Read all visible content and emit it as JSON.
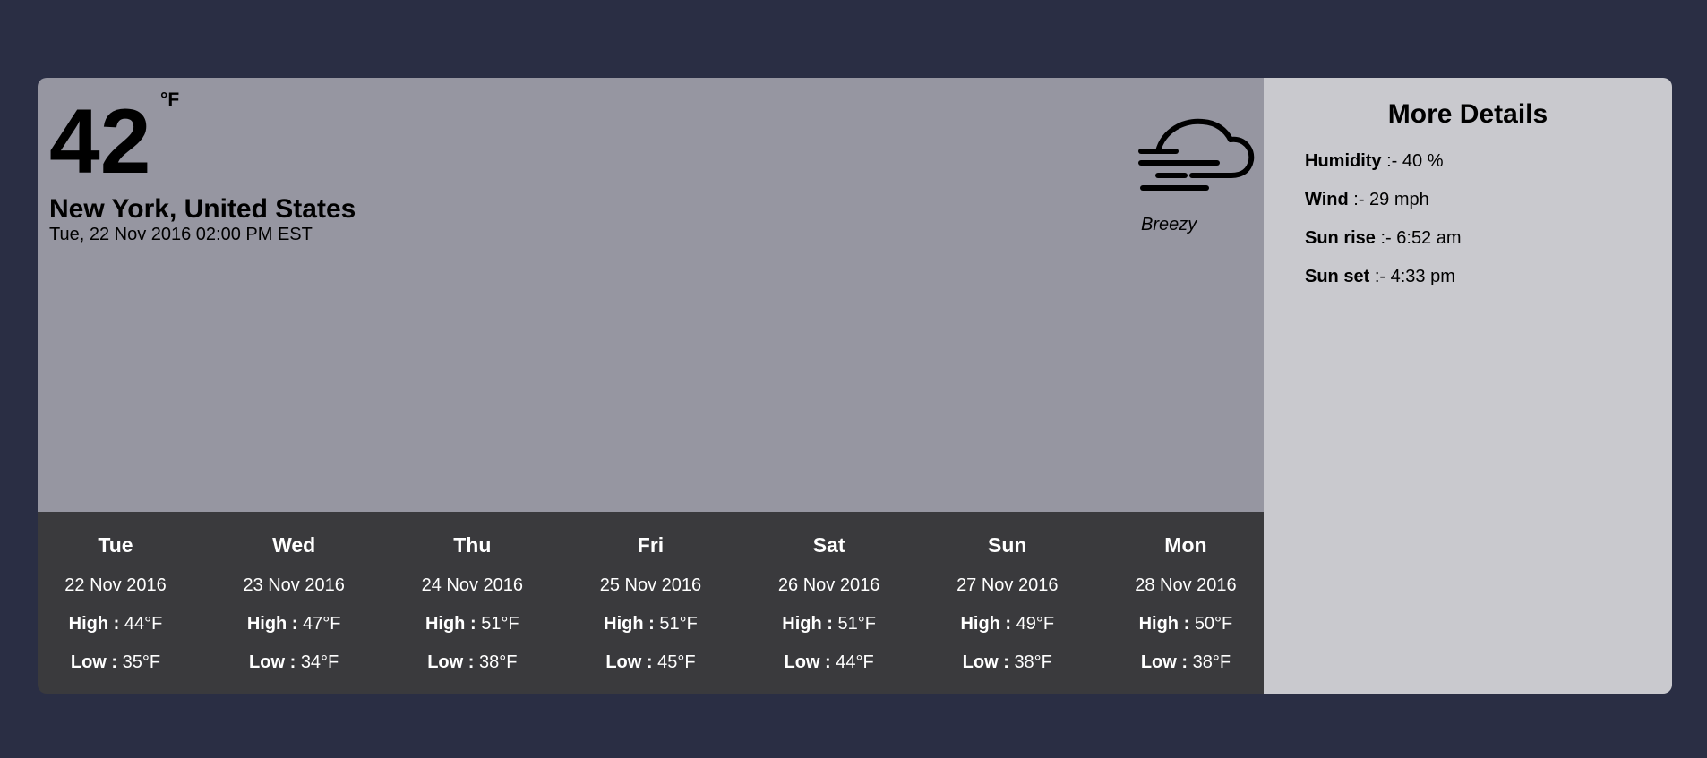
{
  "current": {
    "temperature": "42",
    "unit": "°F",
    "location": "New York, United States",
    "datetime": "Tue, 22 Nov 2016 02:00 PM EST",
    "condition": "Breezy",
    "icon": "windy-cloud-icon"
  },
  "forecast": [
    {
      "day": "Tue",
      "date": "22 Nov 2016",
      "high": "44°F",
      "low": "35°F"
    },
    {
      "day": "Wed",
      "date": "23 Nov 2016",
      "high": "47°F",
      "low": "34°F"
    },
    {
      "day": "Thu",
      "date": "24 Nov 2016",
      "high": "51°F",
      "low": "38°F"
    },
    {
      "day": "Fri",
      "date": "25 Nov 2016",
      "high": "51°F",
      "low": "45°F"
    },
    {
      "day": "Sat",
      "date": "26 Nov 2016",
      "high": "51°F",
      "low": "44°F"
    },
    {
      "day": "Sun",
      "date": "27 Nov 2016",
      "high": "49°F",
      "low": "38°F"
    },
    {
      "day": "Mon",
      "date": "28 Nov 2016",
      "high": "50°F",
      "low": "38°F"
    }
  ],
  "labels": {
    "high": "High :",
    "low": "Low :"
  },
  "details": {
    "title": "More Details",
    "items": [
      {
        "label": "Humidity",
        "value": ":- 40 %"
      },
      {
        "label": "Wind",
        "value": ":- 29 mph"
      },
      {
        "label": "Sun rise",
        "value": ":- 6:52 am"
      },
      {
        "label": "Sun set",
        "value": ":- 4:33 pm"
      }
    ]
  },
  "colors": {
    "background": "#2a2e44",
    "current_panel": "#9696a1",
    "forecast_panel": "#3a3a3d",
    "details_panel": "#c9c9ce"
  }
}
